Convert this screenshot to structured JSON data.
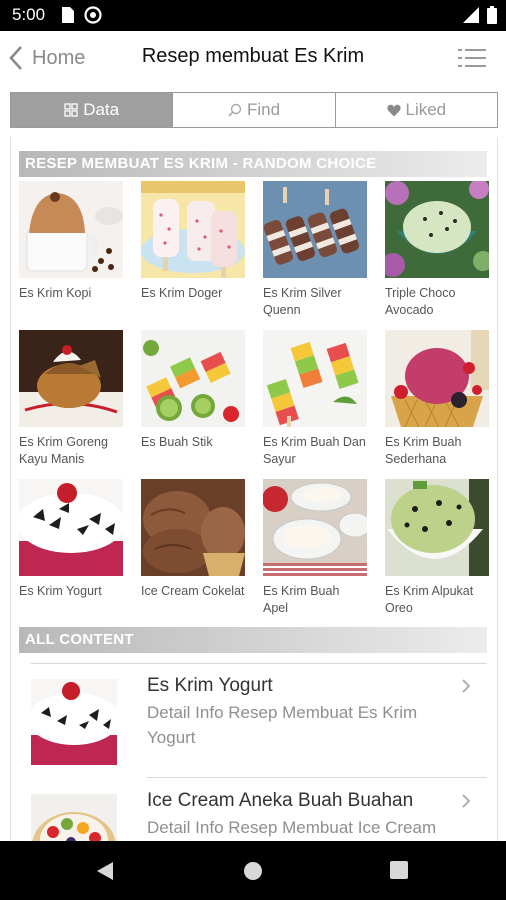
{
  "status": {
    "time": "5:00"
  },
  "header": {
    "back_label": "Home",
    "title": "Resep membuat Es Krim"
  },
  "tabs": [
    {
      "label": "Data",
      "active": true
    },
    {
      "label": "Find",
      "active": false
    },
    {
      "label": "Liked",
      "active": false
    }
  ],
  "random_section": {
    "title": "RESEP MEMBUAT ES KRIM - RANDOM CHOICE",
    "items": [
      {
        "caption": "Es Krim Kopi",
        "thumb": "coffee-ice-cream-cup"
      },
      {
        "caption": "Es Krim Doger",
        "thumb": "pink-popsicles"
      },
      {
        "caption": "Es Krim Silver Quenn",
        "thumb": "chocolate-striped-popsicles"
      },
      {
        "caption": "Triple Choco Avocado",
        "thumb": "green-ice-cream-bowl"
      },
      {
        "caption": "Es Krim Goreng Kayu Manis",
        "thumb": "fried-ice-cream-plate"
      },
      {
        "caption": "Es Buah Stik",
        "thumb": "fruit-popsicles-kiwi"
      },
      {
        "caption": "Es Krim Buah Dan Sayur",
        "thumb": "layered-veggie-popsicles"
      },
      {
        "caption": "Es Krim Buah Sederhana",
        "thumb": "berry-ice-cream-cone"
      },
      {
        "caption": "Es Krim Yogurt",
        "thumb": "yogurt-cherry-cup"
      },
      {
        "caption": "Ice Cream Cokelat",
        "thumb": "chocolate-ice-cream-scoops"
      },
      {
        "caption": "Es Krim Buah Apel",
        "thumb": "apple-ice-cream-bowls"
      },
      {
        "caption": "Es Krim Alpukat Oreo",
        "thumb": "avocado-oreo-ice-cream"
      }
    ]
  },
  "all_section": {
    "title": "ALL CONTENT",
    "items": [
      {
        "title": "Es Krim Yogurt",
        "desc": "Detail Info Resep Membuat Es Krim Yogurt",
        "thumb": "yogurt-cherry-cup"
      },
      {
        "title": "Ice Cream Aneka Buah Buahan",
        "desc": "Detail Info Resep Membuat Ice Cream",
        "thumb": "mixed-fruit-tart"
      }
    ]
  },
  "colors": {
    "active_tab": "#9f9f9f",
    "section_header": "#c4c4c4",
    "status_bar": "#000000"
  },
  "icons": [
    "chevron-left-icon",
    "hamburger-menu-icon",
    "grid-icon",
    "search-icon",
    "heart-icon",
    "chevron-right-icon",
    "back-triangle-icon",
    "home-circle-icon",
    "recents-square-icon"
  ]
}
